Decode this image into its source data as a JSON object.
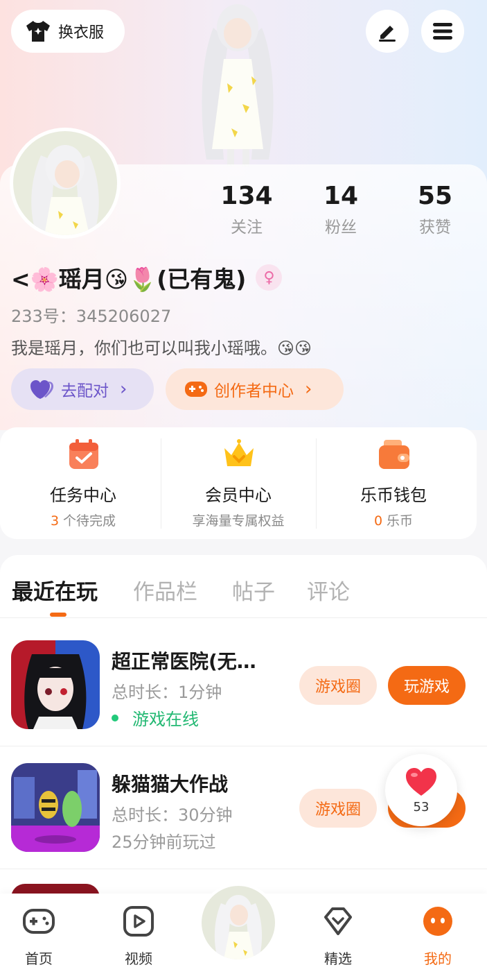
{
  "header": {
    "outfit_label": "换衣服"
  },
  "profile": {
    "stats": [
      {
        "value": "134",
        "label": "关注"
      },
      {
        "value": "14",
        "label": "粉丝"
      },
      {
        "value": "55",
        "label": "获赞"
      }
    ],
    "nickname": "<🌸瑶月😘🌷(已有鬼)",
    "uid": "233号：345206027",
    "bio": "我是瑶月，你们也可以叫我小瑶哦。😘😘",
    "match_label": "去配对",
    "creator_label": "创作者中心"
  },
  "services": [
    {
      "title": "任务中心",
      "accent": "3",
      "sub": "个待完成"
    },
    {
      "title": "会员中心",
      "accent": "",
      "sub": "享海量专属权益"
    },
    {
      "title": "乐币钱包",
      "accent": "0",
      "sub": "乐币"
    }
  ],
  "tabs": [
    "最近在玩",
    "作品栏",
    "帖子",
    "评论"
  ],
  "games": [
    {
      "title": "超正常医院(无…",
      "duration": "总时长：1分钟",
      "status": "游戏在线",
      "circle_label": "游戏圈",
      "play_label": "玩游戏"
    },
    {
      "title": "躲猫猫大作战",
      "duration": "总时长：30分钟",
      "status": "25分钟前玩过",
      "circle_label": "游戏圈",
      "play_label": "玩游戏"
    }
  ],
  "like_count": "53",
  "nav": [
    {
      "label": "首页"
    },
    {
      "label": "视频"
    },
    {
      "label": "精选"
    },
    {
      "label": "我的"
    }
  ],
  "colors": {
    "accent": "#f46a14",
    "online": "#22b872",
    "match": "#6c55c9"
  }
}
